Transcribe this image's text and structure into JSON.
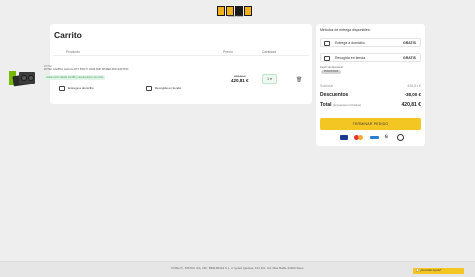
{
  "header": {
    "logo_text": "PCBOX",
    "logo_tagline": "Always Better"
  },
  "cart": {
    "title": "Carrito",
    "columns": {
      "product": "Producto",
      "price": "Precio",
      "quantity": "Cantidad"
    },
    "item": {
      "brand": "ZOTAC",
      "name": "ZOTAC GAMING GeForce RTX 5060 Ti 16GB AMP SPIDER-MAN EDITION",
      "shipping_badge": "Gratis envío rápido 24-48h y devoluciones sin coste",
      "option_home": "Entrega a domicilio",
      "option_store": "Recogida en tienda",
      "old_price": "458,81 €",
      "price": "420,81 €",
      "quantity": "1"
    }
  },
  "summary": {
    "methods_title": "Métodos de entrega disponibles:",
    "methods": [
      {
        "label": "Entrega a domicilio",
        "price": "GRATIS"
      },
      {
        "label": "Recogida en tienda",
        "price": "GRATIS"
      }
    ],
    "coupon_label": "Cupón de descuento",
    "coupon_code": "PCBOX2025",
    "subtotal_label": "Subtotal",
    "subtotal_value": "458,81 €",
    "discount_label": "Descuentos",
    "discount_value": "-38,00 €",
    "total_label": "Total",
    "total_note": "(impuestos incluidos)",
    "total_value": "420,81 €",
    "checkout_label": "TERMINAR PEDIDO",
    "payment_icons": [
      "visa-icon",
      "mastercard-icon",
      "amex-icon",
      "bizum-icon",
      "paypal-icon"
    ]
  },
  "footer": {
    "text": "PCBox®, SISTAC ILS, NIF: B83168419 S.L. c/ Ignasi Iglesias, 161 Pol. Ind. Mas Batlle 43200 Reus"
  },
  "help": {
    "label": "¿Necesitas ayuda?"
  },
  "colors": {
    "accent": "#f3c623",
    "shipping_green": "#3d9a60",
    "background": "#eeeeee"
  }
}
